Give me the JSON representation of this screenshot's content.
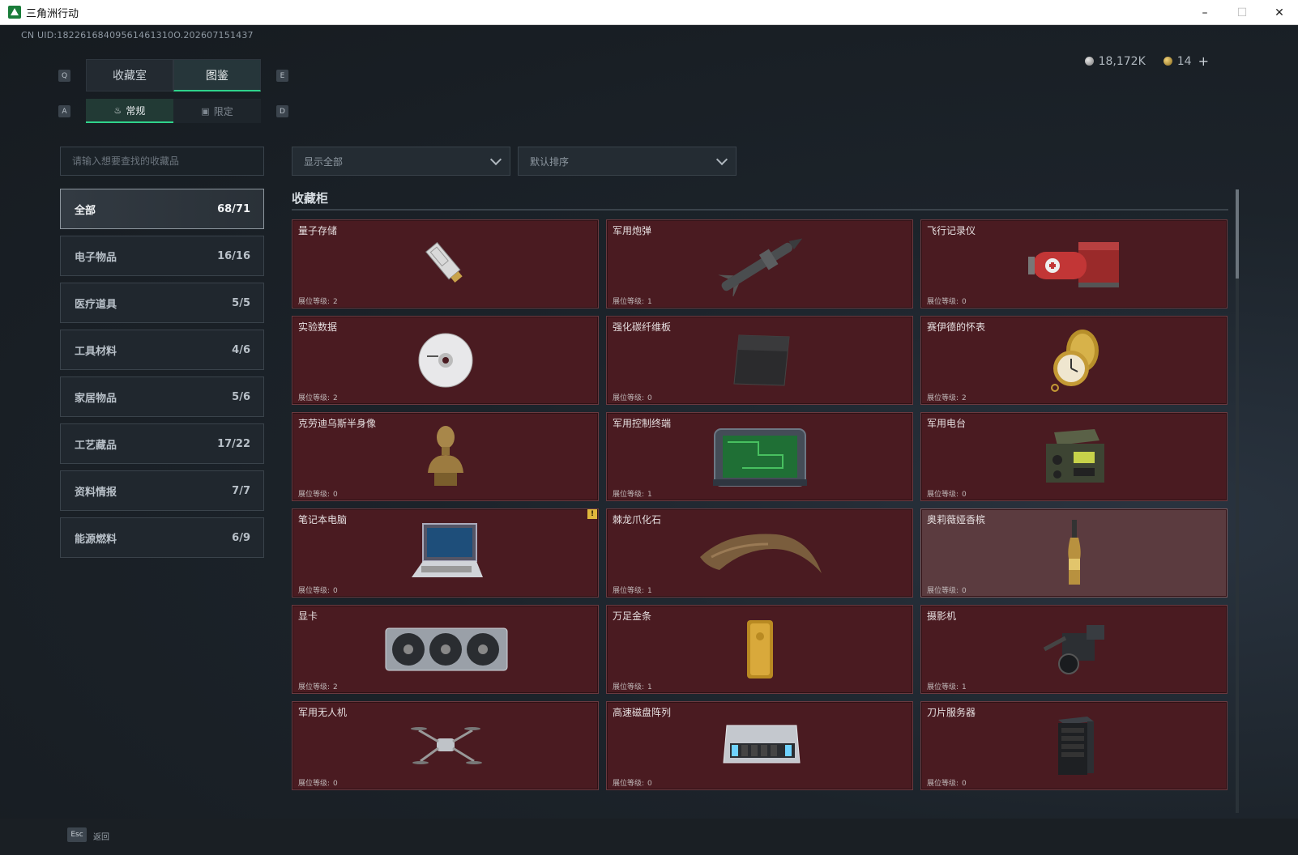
{
  "window": {
    "title": "三角洲行动",
    "minimize": "–",
    "maximize": "☐",
    "close": "✕"
  },
  "uid": "CN UID:18226168409561461310O.202607151437",
  "currency": {
    "silver": "18,172K",
    "gold": "14",
    "add": "+"
  },
  "tabs": [
    {
      "label": "收藏室"
    },
    {
      "label": "图鉴"
    }
  ],
  "tab_keys": {
    "left": "Q",
    "right": "E"
  },
  "subtabs": [
    {
      "label": "常规"
    },
    {
      "label": "限定"
    }
  ],
  "subtab_keys": {
    "left": "A",
    "right": "D"
  },
  "search": {
    "placeholder": "请输入想要查找的收藏品"
  },
  "filters": {
    "show": "显示全部",
    "sort": "默认排序"
  },
  "categories": [
    {
      "label": "全部",
      "count": "68/71"
    },
    {
      "label": "电子物品",
      "count": "16/16"
    },
    {
      "label": "医疗道具",
      "count": "5/5"
    },
    {
      "label": "工具材料",
      "count": "4/6"
    },
    {
      "label": "家居物品",
      "count": "5/6"
    },
    {
      "label": "工艺藏品",
      "count": "17/22"
    },
    {
      "label": "资料情报",
      "count": "7/7"
    },
    {
      "label": "能源燃料",
      "count": "6/9"
    }
  ],
  "section_title": "收藏柜",
  "level_label": "展位等级:",
  "items": [
    {
      "name": "量子存储",
      "level": "2",
      "icon": "usb-drive-icon"
    },
    {
      "name": "军用炮弹",
      "level": "1",
      "icon": "missile-icon"
    },
    {
      "name": "飞行记录仪",
      "level": "0",
      "icon": "flight-recorder-icon"
    },
    {
      "name": "实验数据",
      "level": "2",
      "icon": "disc-icon"
    },
    {
      "name": "强化碳纤维板",
      "level": "0",
      "icon": "carbon-plate-icon"
    },
    {
      "name": "赛伊德的怀表",
      "level": "2",
      "icon": "pocket-watch-icon"
    },
    {
      "name": "克劳迪乌斯半身像",
      "level": "0",
      "icon": "bust-icon"
    },
    {
      "name": "军用控制终端",
      "level": "1",
      "icon": "terminal-icon"
    },
    {
      "name": "军用电台",
      "level": "0",
      "icon": "radio-icon"
    },
    {
      "name": "笔记本电脑",
      "level": "0",
      "icon": "laptop-icon",
      "badge": "!"
    },
    {
      "name": "棘龙爪化石",
      "level": "1",
      "icon": "claw-fossil-icon"
    },
    {
      "name": "奥莉薇娅香槟",
      "level": "0",
      "icon": "champagne-icon"
    },
    {
      "name": "显卡",
      "level": "2",
      "icon": "graphics-card-icon"
    },
    {
      "name": "万足金条",
      "level": "1",
      "icon": "gold-bar-icon"
    },
    {
      "name": "摄影机",
      "level": "1",
      "icon": "camera-icon"
    },
    {
      "name": "军用无人机",
      "level": "0",
      "icon": "drone-icon"
    },
    {
      "name": "高速磁盘阵列",
      "level": "0",
      "icon": "disk-array-icon"
    },
    {
      "name": "刀片服务器",
      "level": "0",
      "icon": "server-icon"
    }
  ],
  "footer": {
    "esc_key": "Esc",
    "esc_label": "返回"
  }
}
